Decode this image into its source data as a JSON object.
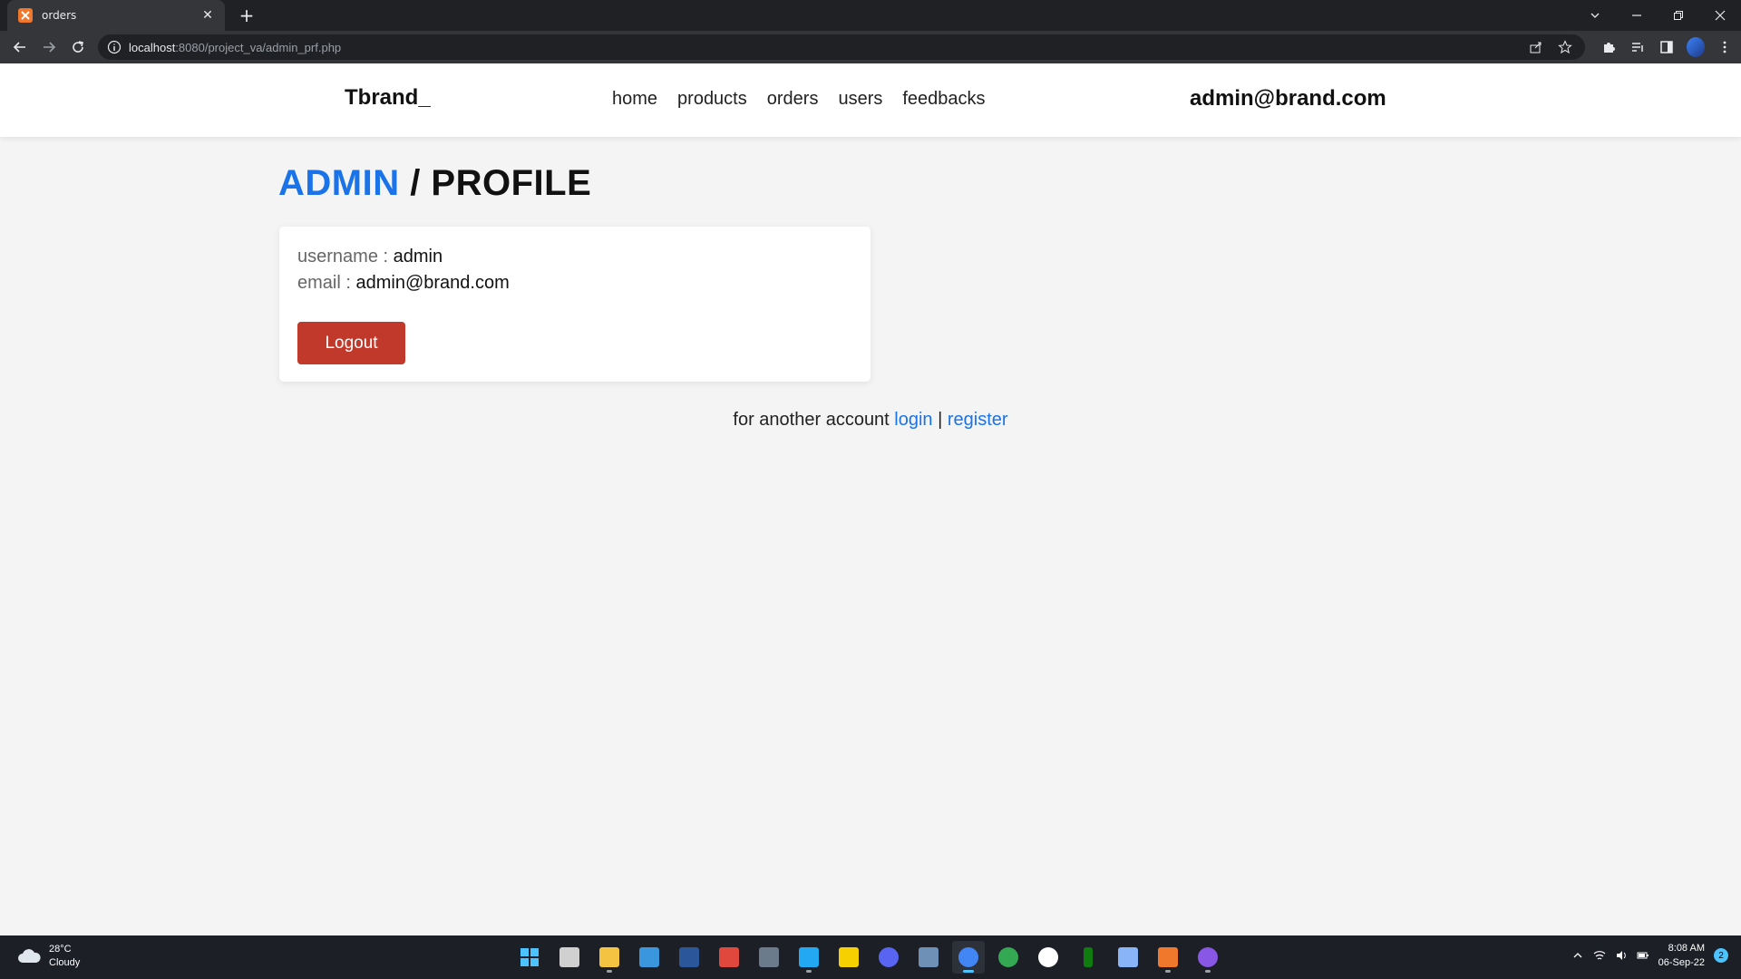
{
  "browser": {
    "tab_title": "orders",
    "new_tab_label": "+",
    "url_host": "localhost",
    "url_rest": ":8080/project_va/admin_prf.php"
  },
  "site": {
    "logo": "Tbrand_",
    "nav": [
      "home",
      "products",
      "orders",
      "users",
      "feedbacks"
    ],
    "header_email": "admin@brand.com"
  },
  "page": {
    "title_accent": "ADMIN",
    "title_rest": " / PROFILE",
    "username_label": "username : ",
    "username_value": "admin",
    "email_label": "email : ",
    "email_value": "admin@brand.com",
    "logout_label": "Logout",
    "alt_text": "for another account ",
    "login_label": "login",
    "separator": " | ",
    "register_label": "register"
  },
  "taskbar": {
    "weather_temp": "28°C",
    "weather_desc": "Cloudy",
    "time": "8:08 AM",
    "date": "06-Sep-22",
    "notification_count": "2",
    "app_colors": [
      "#0078d4",
      "#d0d0d0",
      "#f5c342",
      "#3a96dd",
      "#2b579a",
      "#e0483e",
      "#6b7b8c",
      "#23a9f2",
      "#f7d000",
      "#5865f2",
      "#6e8fb6",
      "#4285f4",
      "#34a853",
      "#ffffff",
      "#107c10",
      "#8ab4f8",
      "#f0782d",
      "#8957e5"
    ]
  },
  "colors": {
    "accent": "#1a73e8",
    "logout": "#c0392b"
  }
}
